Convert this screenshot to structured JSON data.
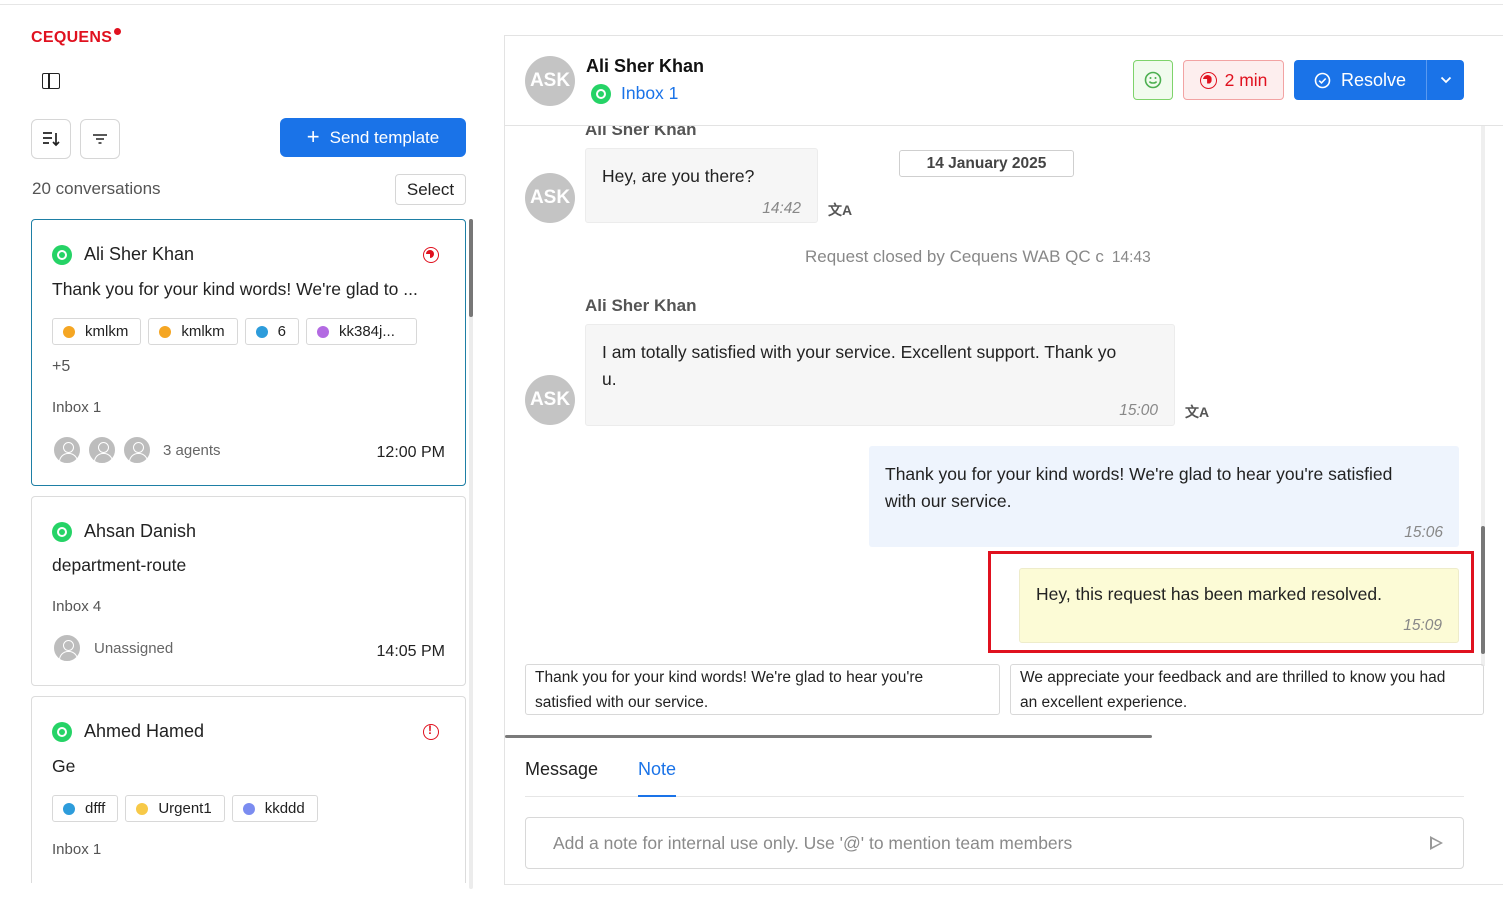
{
  "brand": {
    "logo_text": "CEQUENS",
    "accent": "#e0111f",
    "primary": "#1a73e8"
  },
  "sidebar": {
    "send_template_label": "Send template",
    "conversation_count": "20 conversations",
    "select_label": "Select",
    "conversations": [
      {
        "name": "Ali Sher Khan",
        "preview": "Thank you for your kind words! We're glad to ...",
        "tags": [
          {
            "label": "kmlkm",
            "color": "#f5a623"
          },
          {
            "label": "kmlkm",
            "color": "#f5a623"
          },
          {
            "label": "6",
            "color": "#2d9cdb"
          },
          {
            "label": "kk384j...",
            "color": "#b36ae2"
          }
        ],
        "more": "+5",
        "inbox": "Inbox 1",
        "agents": "3 agents",
        "time": "12:00 PM"
      },
      {
        "name": "Ahsan Danish",
        "preview": "department-route",
        "inbox": "Inbox 4",
        "agents": "Unassigned",
        "time": "14:05 PM"
      },
      {
        "name": "Ahmed Hamed",
        "preview": "Ge",
        "tags": [
          {
            "label": "dfff",
            "color": "#2d9cdb"
          },
          {
            "label": "Urgent1",
            "color": "#f7c948"
          },
          {
            "label": "kkddd",
            "color": "#7b8cf0"
          }
        ],
        "inbox": "Inbox 1"
      }
    ]
  },
  "chat": {
    "avatar_initials": "ASK",
    "contact_name": "Ali Sher Khan",
    "inbox": "Inbox 1",
    "timer": "2 min",
    "resolve_label": "Resolve",
    "messages": {
      "sender_top": "Ali Sher Khan",
      "msg1_text": "Hey, are you there?",
      "msg1_time": "14:42",
      "date_label": "14 January 2025",
      "system_text": "Request closed by Cequens WAB QC c",
      "system_time": "14:43",
      "sender_2": "Ali Sher Khan",
      "msg2_line1": "I am totally satisfied with your service. Excellent support. Thank yo",
      "msg2_line2": "u.",
      "msg2_time": "15:00",
      "msg3_line1": "Thank you for your kind words! We're glad to hear you're satisfied",
      "msg3_line2": "with our service.",
      "msg3_time": "15:06",
      "msg4_text": "Hey, this request has been marked resolved.",
      "msg4_time": "15:09"
    },
    "suggestions": [
      {
        "line1": "Thank you for your kind words! We're glad to hear you're",
        "line2": "satisfied with our service."
      },
      {
        "line1": "We appreciate your feedback and are thrilled to know you had",
        "line2": "an excellent experience."
      }
    ],
    "tabs": [
      {
        "label": "Message"
      },
      {
        "label": "Note"
      }
    ],
    "note_placeholder": "Add a note for internal use only. Use '@' to mention team members"
  }
}
